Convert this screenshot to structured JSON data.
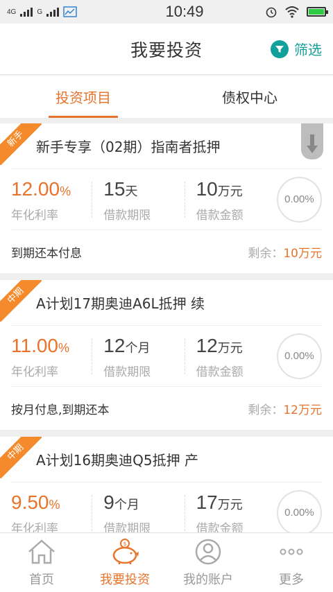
{
  "status": {
    "net1": "4G",
    "net2": "G",
    "time": "10:49"
  },
  "header": {
    "title": "我要投资",
    "filter_label": "筛选"
  },
  "tabs": [
    {
      "label": "投资项目",
      "active": true
    },
    {
      "label": "债权中心",
      "active": false
    }
  ],
  "cards": [
    {
      "badge": "新手",
      "title": "新手专享（02期）指南者抵押",
      "rate": "12.00",
      "rate_unit": "%",
      "rate_label": "年化利率",
      "term": "15",
      "term_unit": "天",
      "term_label": "借款期限",
      "amount": "10",
      "amount_unit": "万元",
      "amount_label": "借款金额",
      "progress": "0.00%",
      "repay": "到期还本付息",
      "remain_label": "剩余：",
      "remain_value": "10万元"
    },
    {
      "badge": "中期",
      "title": "A计划17期奥迪A6L抵押 续",
      "rate": "11.00",
      "rate_unit": "%",
      "rate_label": "年化利率",
      "term": "12",
      "term_unit": "个月",
      "term_label": "借款期限",
      "amount": "12",
      "amount_unit": "万元",
      "amount_label": "借款金额",
      "progress": "0.00%",
      "repay": "按月付息,到期还本",
      "remain_label": "剩余：",
      "remain_value": "12万元"
    },
    {
      "badge": "中期",
      "title": "A计划16期奥迪Q5抵押 产",
      "rate": "9.50",
      "rate_unit": "%",
      "rate_label": "年化利率",
      "term": "9",
      "term_unit": "个月",
      "term_label": "借款期限",
      "amount": "17",
      "amount_unit": "万元",
      "amount_label": "借款金额",
      "progress": "0.00%"
    }
  ],
  "nav": [
    {
      "label": "首页",
      "icon": "home-icon"
    },
    {
      "label": "我要投资",
      "icon": "piggy-bank-icon",
      "active": true
    },
    {
      "label": "我的账户",
      "icon": "user-icon"
    },
    {
      "label": "更多",
      "icon": "more-icon"
    }
  ],
  "colors": {
    "accent": "#e8732b",
    "teal": "#14a09a"
  }
}
